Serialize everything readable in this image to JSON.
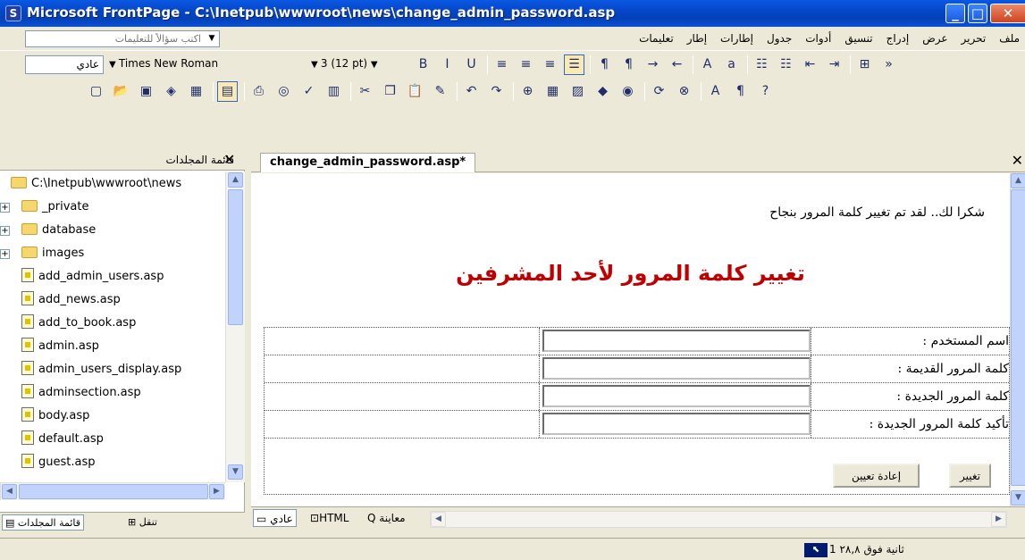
{
  "window": {
    "title": "Microsoft FrontPage - C:\\Inetpub\\wwwroot\\news\\change_admin_password.asp",
    "app_icon": "frontpage-icon",
    "controls": [
      "minimize-icon",
      "maximize-icon",
      "close-icon"
    ]
  },
  "menubar": {
    "ask_placeholder": "اكتب سؤالاً للتعليمات",
    "items": [
      "ملف",
      "تحرير",
      "عرض",
      "إدراج",
      "تنسيق",
      "أدوات",
      "جدول",
      "إطارات",
      "إطار",
      "تعليمات"
    ]
  },
  "format_toolbar": {
    "style": "عادي",
    "font": "Times New Roman",
    "size": "3 (12 pt)",
    "icons": [
      "bold-icon",
      "italic-icon",
      "underline-icon",
      "align-left-icon",
      "align-center-icon",
      "align-right-icon",
      "justify-icon",
      "ltr-icon",
      "rtl-icon",
      "arrow-right-icon",
      "arrow-left-icon",
      "increase-font-icon",
      "decrease-font-icon",
      "numbering-icon",
      "bullets-icon",
      "decrease-indent-icon",
      "increase-indent-icon",
      "border-icon",
      "more-icon"
    ]
  },
  "standard_toolbar": {
    "icons": [
      "new-page-icon",
      "open-icon",
      "save-icon",
      "publish-icon",
      "web-component-icon",
      "toggle-pane-icon",
      "print-icon",
      "preview-icon",
      "spelling-icon",
      "research-icon",
      "cut-icon",
      "copy-icon",
      "paste-icon",
      "format-painter-icon",
      "undo-icon",
      "redo-icon",
      "insert-component-icon",
      "insert-table-icon",
      "insert-picture-icon",
      "drawing-icon",
      "hyperlink-icon",
      "refresh-icon",
      "stop-icon",
      "font-color-icon",
      "show-all-icon",
      "help-icon"
    ]
  },
  "folder_panel": {
    "title": "قائمة المجلدات",
    "root": "C:\\Inetpub\\wwwroot\\news",
    "items": [
      {
        "name": "_private",
        "type": "folder",
        "expandable": true
      },
      {
        "name": "database",
        "type": "folder",
        "expandable": true
      },
      {
        "name": "images",
        "type": "folder",
        "expandable": true
      },
      {
        "name": "add_admin_users.asp",
        "type": "file"
      },
      {
        "name": "add_news.asp",
        "type": "file"
      },
      {
        "name": "add_to_book.asp",
        "type": "file"
      },
      {
        "name": "admin.asp",
        "type": "file"
      },
      {
        "name": "admin_users_display.asp",
        "type": "file"
      },
      {
        "name": "adminsection.asp",
        "type": "file"
      },
      {
        "name": "body.asp",
        "type": "file"
      },
      {
        "name": "default.asp",
        "type": "home-file"
      },
      {
        "name": "guest.asp",
        "type": "file"
      }
    ],
    "tabs": [
      "قائمة المجلدات",
      "تنقل"
    ]
  },
  "editor": {
    "tab_label": "change_admin_password.asp*",
    "thanks_message": "شكرا لك.. لقد تم تغيير كلمة المرور بنجاح",
    "heading": "تغيير كلمة المرور لأحد المشرفين",
    "form": {
      "fields": [
        {
          "label": "اسم المستخدم :",
          "value": ""
        },
        {
          "label": "كلمة المرور القديمة :",
          "value": ""
        },
        {
          "label": "كلمة المرور الجديدة :",
          "value": ""
        },
        {
          "label": "تأكيد كلمة المرور الجديدة :",
          "value": ""
        }
      ],
      "submit_label": "تغيير",
      "reset_label": "إعادة تعيين"
    },
    "view_tabs": [
      "عادي",
      "HTML",
      "معاينة"
    ],
    "selected_view": "عادي"
  },
  "statusbar": {
    "text": "ثانية فوق ٢٨,٨ 1"
  },
  "colors": {
    "title_bar": "#0546c8",
    "heading": "#c00000",
    "chrome": "#ece9d8"
  }
}
